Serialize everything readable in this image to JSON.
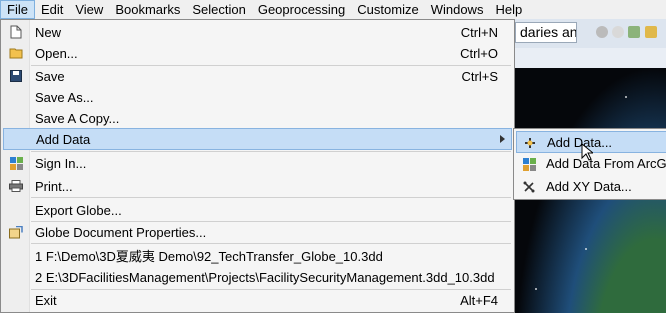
{
  "menubar": {
    "items": [
      "File",
      "Edit",
      "View",
      "Bookmarks",
      "Selection",
      "Geoprocessing",
      "Customize",
      "Windows",
      "Help"
    ]
  },
  "toolbar": {
    "layer_dropdown_value": "daries anc"
  },
  "file_menu": {
    "new": {
      "label": "New",
      "shortcut": "Ctrl+N"
    },
    "open": {
      "label": "Open...",
      "shortcut": "Ctrl+O"
    },
    "save": {
      "label": "Save",
      "shortcut": "Ctrl+S"
    },
    "save_as": {
      "label": "Save As..."
    },
    "save_copy": {
      "label": "Save A Copy..."
    },
    "add_data": {
      "label": "Add Data"
    },
    "sign_in": {
      "label": "Sign In..."
    },
    "print": {
      "label": "Print..."
    },
    "export_globe": {
      "label": "Export Globe..."
    },
    "doc_props": {
      "label": "Globe Document Properties..."
    },
    "recent_1": {
      "label": "1 F:\\Demo\\3D夏威夷 Demo\\92_TechTransfer_Globe_10.3dd"
    },
    "recent_2": {
      "label": "2 E:\\3DFacilitiesManagement\\Projects\\FacilitySecurityManagement.3dd_10.3dd"
    },
    "exit": {
      "label": "Exit",
      "shortcut": "Alt+F4"
    }
  },
  "add_data_submenu": {
    "items": [
      "Add Data...",
      "Add Data From ArcGI",
      "Add XY Data..."
    ]
  },
  "colors": {
    "highlight": "#c5ddf6",
    "highlight_border": "#88b3e0",
    "menu_bg": "#f5f5f5"
  }
}
